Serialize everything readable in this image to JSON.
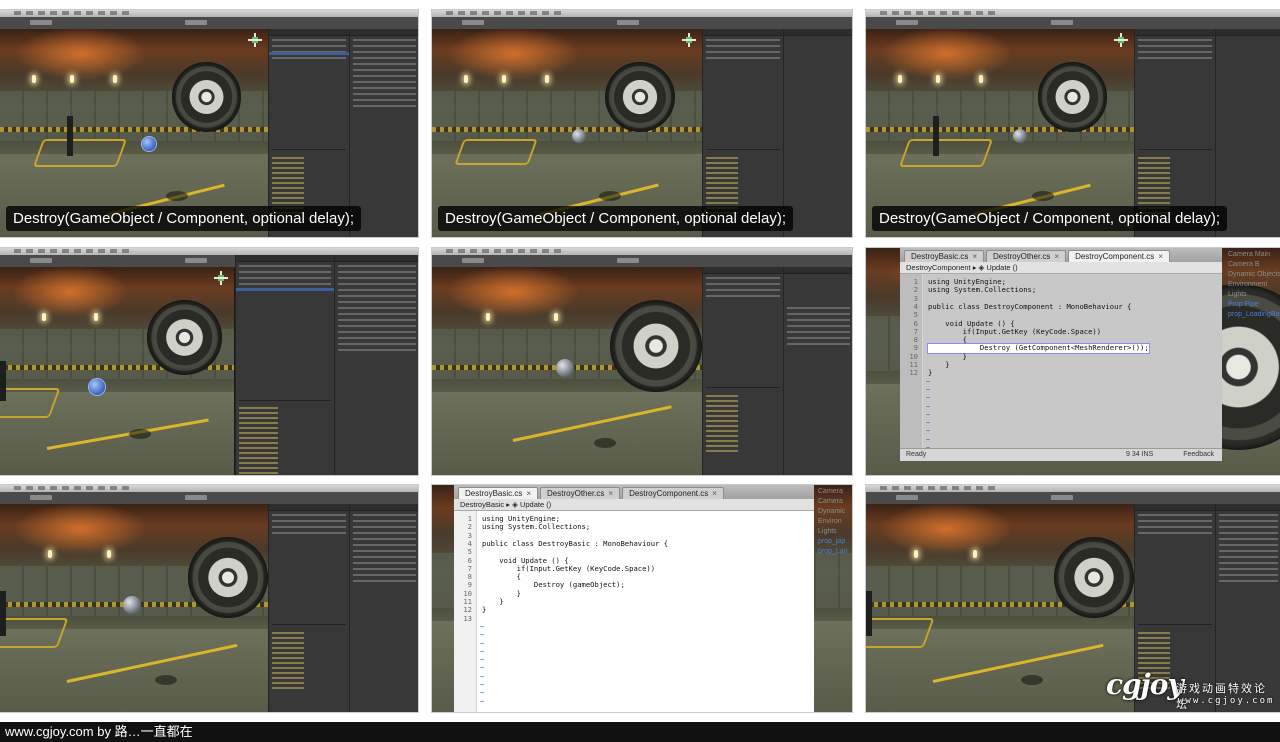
{
  "caption": "Destroy(GameObject / Component, optional delay);",
  "footer": {
    "credit": "www.cgjoy.com by 路…一直都在"
  },
  "watermark": {
    "logo": "cgjoy",
    "tagline": "游戏动画特效论坛",
    "url": "www.cgjoy.com"
  },
  "editor1": {
    "tabs": [
      "DestroyBasic.cs",
      "DestroyOther.cs",
      "DestroyComponent.cs"
    ],
    "active_tab": 2,
    "breadcrumb": "DestroyComponent ▸ ◈ Update ()",
    "lines": [
      "using UnityEngine;",
      "using System.Collections;",
      "",
      "public class DestroyComponent : MonoBehaviour {",
      "",
      "    void Update () {",
      "        if(Input.GetKey (KeyCode.Space))",
      "        {",
      "            Destroy (GetComponent<MeshRenderer>());",
      "        }",
      "    }",
      "}"
    ],
    "status_left": "Ready",
    "status_pos": "9   34   INS",
    "status_feedback": "Feedback",
    "sidebar": [
      "Camera Main",
      "Camera B",
      "Dynamic Objects",
      "Environment",
      "Lights",
      "Prop Pipe",
      "prop_LoadingBay"
    ]
  },
  "editor2": {
    "tabs": [
      "DestroyBasic.cs",
      "DestroyOther.cs",
      "DestroyComponent.cs"
    ],
    "active_tab": 0,
    "breadcrumb": "DestroyBasic ▸ ◈ Update ()",
    "lines": [
      "using UnityEngine;",
      "using System.Collections;",
      "",
      "public class DestroyBasic : MonoBehaviour {",
      "",
      "    void Update () {",
      "        if(Input.GetKey (KeyCode.Space))",
      "        {",
      "            Destroy (gameObject);",
      "        }",
      "    }",
      "}",
      ""
    ],
    "sidebar": [
      "Camera",
      "Camera",
      "Dynamic",
      "Environ",
      "Lights",
      "prop_pip",
      "prop_Lan"
    ]
  }
}
